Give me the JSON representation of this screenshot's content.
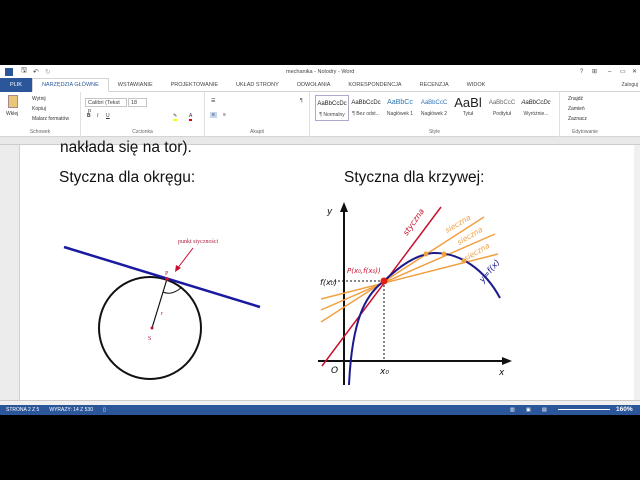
{
  "titlebar": {
    "title": "mechanika - Nolodry - Word",
    "help": "?",
    "controls": [
      "⊞",
      "–",
      "▭",
      "✕"
    ]
  },
  "tabs": [
    "PLIK",
    "NARZĘDZIA GŁÓWNE",
    "WSTAWIANIE",
    "PROJEKTOWANIE",
    "UKŁAD STRONY",
    "ODWOŁANIA",
    "KORESPONDENCJA",
    "RECENZJA",
    "WIDOK"
  ],
  "signin": "Zaloguj",
  "ribbon": {
    "clipboard": {
      "paste": "Wklej",
      "cut": "Wytnij",
      "copy": "Kopiuj",
      "format_painter": "Malarz formatów",
      "label": "Schowek"
    },
    "font": {
      "name": "Calibri (Tekst p",
      "size": "18",
      "label": "Czcionka"
    },
    "paragraph": {
      "label": "Akapit"
    },
    "styles": {
      "items": [
        {
          "preview": "AaBbCcDc",
          "name": "¶ Normalny"
        },
        {
          "preview": "AaBbCcDc",
          "name": "¶ Bez odst..."
        },
        {
          "preview": "AaBbCc",
          "name": "Nagłówek 1"
        },
        {
          "preview": "AaBbCcC",
          "name": "Nagłówek 2"
        },
        {
          "preview": "AaBl",
          "name": "Tytuł"
        },
        {
          "preview": "AaBbCcC",
          "name": "Podtytuł"
        },
        {
          "preview": "AaBbCcDc",
          "name": "Wyróżnie..."
        }
      ],
      "label": "Style"
    },
    "editing": {
      "find": "Znajdź",
      "replace": "Zamień",
      "select": "Zaznacz",
      "label": "Edytowanie"
    }
  },
  "document": {
    "prev_line": "nakłada się na tor).",
    "heading_left": "Styczna dla okręgu:",
    "heading_right": "Styczna dla krzywej:",
    "circle_fig": {
      "point_label": "punkt styczności",
      "P": "P",
      "r": "r",
      "S": "S"
    },
    "curve_fig": {
      "y": "y",
      "x": "x",
      "O": "O",
      "x0": "x₀",
      "fx0": "f(x₀)",
      "P": "P(x₀,f(x₀))",
      "tangent": "styczna",
      "secant": "sieczna",
      "curve": "y=f(x)"
    },
    "colors": {
      "tangent_line": "#1a1aa0",
      "tangent_curve": "#c8102e",
      "secant": "#f0a040",
      "curve": "#1a1a8c"
    }
  },
  "status": {
    "page": "STRONA 2 Z 5",
    "words": "WYRAZY: 14 Z 530",
    "zoom": "160%"
  }
}
